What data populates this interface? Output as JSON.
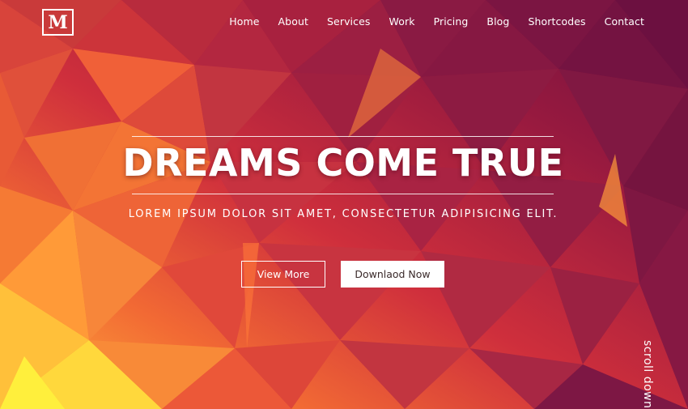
{
  "brand": {
    "logo_letter": "M"
  },
  "nav": {
    "items": [
      "Home",
      "About",
      "Services",
      "Work",
      "Pricing",
      "Blog",
      "Shortcodes",
      "Contact"
    ]
  },
  "hero": {
    "title": "DREAMS COME TRUE",
    "subtitle": "LOREM IPSUM DOLOR SIT AMET, CONSECTETUR ADIPISICING ELIT.",
    "view_more_label": "View More",
    "download_label": "Downlaod Now"
  },
  "scroll": {
    "label": "scroll down"
  },
  "colors": {
    "deep_purple": "#6e1140",
    "magenta": "#8a1a44",
    "crimson": "#b5283f",
    "red": "#d93a3a",
    "orange": "#f06a35",
    "yellow_orange": "#ffa63a",
    "yellow": "#ffe43a"
  }
}
